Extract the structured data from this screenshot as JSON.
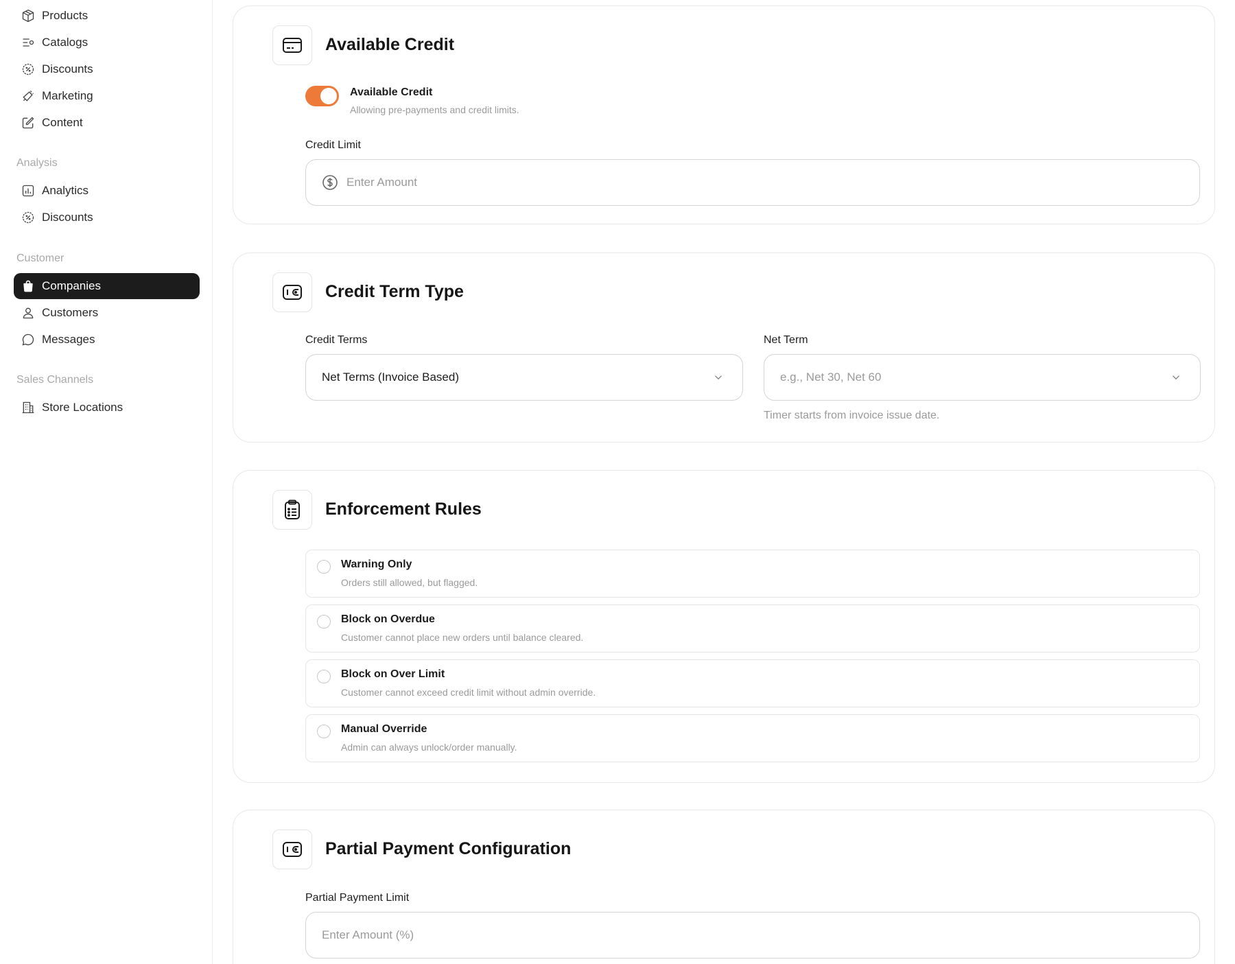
{
  "sidebar": {
    "top_items": [
      {
        "label": "Products",
        "icon": "box-icon"
      },
      {
        "label": "Catalogs",
        "icon": "catalog-icon"
      },
      {
        "label": "Discounts",
        "icon": "discount-icon"
      },
      {
        "label": "Marketing",
        "icon": "megaphone-icon"
      },
      {
        "label": "Content",
        "icon": "edit-icon"
      }
    ],
    "analysis": {
      "label": "Analysis",
      "items": [
        {
          "label": "Analytics",
          "icon": "chart-icon"
        },
        {
          "label": "Discounts",
          "icon": "discount-icon"
        }
      ]
    },
    "customer": {
      "label": "Customer",
      "items": [
        {
          "label": "Companies",
          "icon": "bag-icon",
          "active": true
        },
        {
          "label": "Customers",
          "icon": "user-icon"
        },
        {
          "label": "Messages",
          "icon": "chat-icon"
        }
      ]
    },
    "sales": {
      "label": "Sales Channels",
      "items": [
        {
          "label": "Store Locations",
          "icon": "building-icon"
        }
      ]
    }
  },
  "available_credit": {
    "title": "Available Credit",
    "toggle_title": "Available Credit",
    "toggle_sub": "Allowing pre-payments and credit limits.",
    "toggle_on": true,
    "limit_label": "Credit Limit",
    "limit_placeholder": "Enter Amount"
  },
  "credit_term": {
    "title": "Credit Term Type",
    "terms_label": "Credit Terms",
    "terms_value": "Net Terms (Invoice Based)",
    "net_label": "Net Term",
    "net_placeholder": "e.g., Net 30, Net 60",
    "net_helper": "Timer starts from invoice issue date."
  },
  "enforcement": {
    "title": "Enforcement Rules",
    "options": [
      {
        "title": "Warning Only",
        "desc": "Orders still allowed, but flagged."
      },
      {
        "title": "Block on Overdue",
        "desc": "Customer cannot place new orders until balance cleared."
      },
      {
        "title": "Block on Over Limit",
        "desc": "Customer cannot exceed credit limit without admin override."
      },
      {
        "title": "Manual Override",
        "desc": "Admin can always unlock/order manually."
      }
    ]
  },
  "partial_payment": {
    "title": "Partial Payment Configuration",
    "limit_label": "Partial Payment Limit",
    "limit_placeholder": "Enter Amount (%)"
  },
  "colors": {
    "accent": "#ee7a3a",
    "active_nav": "#1c1c1c"
  }
}
